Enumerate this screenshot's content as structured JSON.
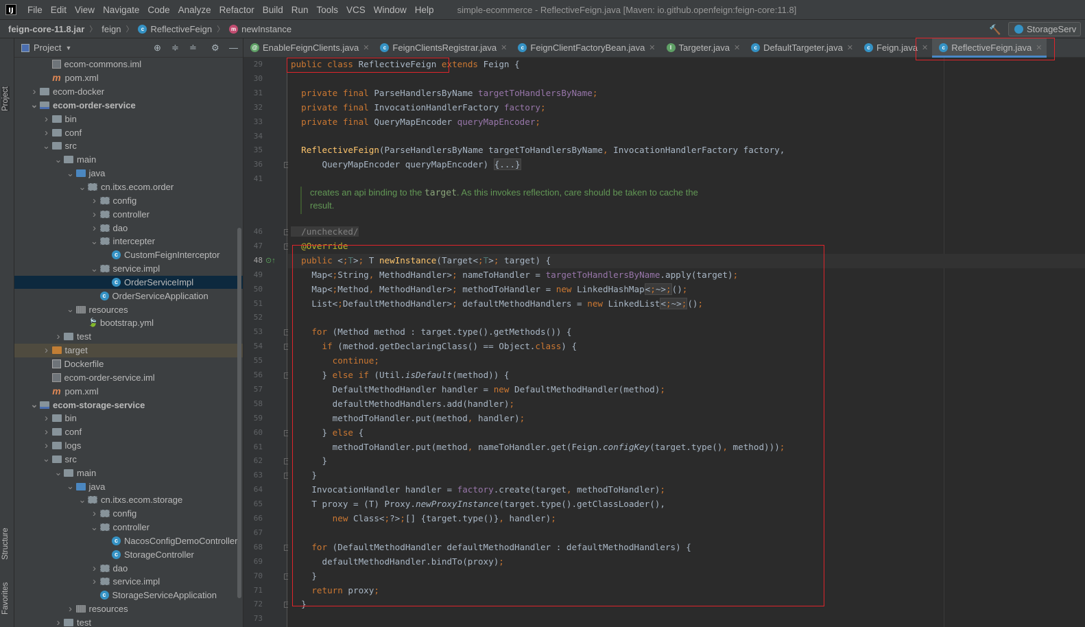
{
  "menubar": {
    "items": [
      "File",
      "Edit",
      "View",
      "Navigate",
      "Code",
      "Analyze",
      "Refactor",
      "Build",
      "Run",
      "Tools",
      "VCS",
      "Window",
      "Help"
    ],
    "window_title": "simple-ecommerce - ReflectiveFeign.java [Maven: io.github.openfeign:feign-core:11.8]"
  },
  "navbar": {
    "crumbs": [
      "feign-core-11.8.jar",
      "feign",
      "ReflectiveFeign",
      "newInstance"
    ],
    "run_config": "StorageServ"
  },
  "side_tabs": {
    "project": "Project",
    "structure": "Structure",
    "favorites": "Favorites"
  },
  "project": {
    "title": "Project",
    "tree": [
      {
        "label": "ecom-commons.iml",
        "indent": 3,
        "icon": "iml",
        "arrow": ""
      },
      {
        "label": "pom.xml",
        "indent": 3,
        "icon": "xml",
        "arrow": ""
      },
      {
        "label": "ecom-docker",
        "indent": 2,
        "icon": "folder",
        "arrow": ">"
      },
      {
        "label": "ecom-order-service",
        "indent": 2,
        "icon": "mod",
        "arrow": "v",
        "bold": true
      },
      {
        "label": "bin",
        "indent": 3,
        "icon": "folder",
        "arrow": ">"
      },
      {
        "label": "conf",
        "indent": 3,
        "icon": "folder",
        "arrow": ">"
      },
      {
        "label": "src",
        "indent": 3,
        "icon": "folder",
        "arrow": "v"
      },
      {
        "label": "main",
        "indent": 4,
        "icon": "folder",
        "arrow": "v"
      },
      {
        "label": "java",
        "indent": 5,
        "icon": "src",
        "arrow": "v"
      },
      {
        "label": "cn.itxs.ecom.order",
        "indent": 6,
        "icon": "pkg",
        "arrow": "v"
      },
      {
        "label": "config",
        "indent": 7,
        "icon": "pkg",
        "arrow": ">"
      },
      {
        "label": "controller",
        "indent": 7,
        "icon": "pkg",
        "arrow": ">"
      },
      {
        "label": "dao",
        "indent": 7,
        "icon": "pkg",
        "arrow": ">"
      },
      {
        "label": "intercepter",
        "indent": 7,
        "icon": "pkg",
        "arrow": "v"
      },
      {
        "label": "CustomFeignInterceptor",
        "indent": 8,
        "icon": "cls",
        "arrow": ""
      },
      {
        "label": "service.impl",
        "indent": 7,
        "icon": "pkg",
        "arrow": "v"
      },
      {
        "label": "OrderServiceImpl",
        "indent": 8,
        "icon": "cls",
        "arrow": "",
        "selected": true
      },
      {
        "label": "OrderServiceApplication",
        "indent": 7,
        "icon": "cls",
        "arrow": ""
      },
      {
        "label": "resources",
        "indent": 5,
        "icon": "res",
        "arrow": "v"
      },
      {
        "label": "bootstrap.yml",
        "indent": 6,
        "icon": "yml",
        "arrow": ""
      },
      {
        "label": "test",
        "indent": 4,
        "icon": "folder",
        "arrow": ">"
      },
      {
        "label": "target",
        "indent": 3,
        "icon": "tgt",
        "arrow": ">",
        "excluded": true
      },
      {
        "label": "Dockerfile",
        "indent": 3,
        "icon": "doc",
        "arrow": ""
      },
      {
        "label": "ecom-order-service.iml",
        "indent": 3,
        "icon": "iml",
        "arrow": ""
      },
      {
        "label": "pom.xml",
        "indent": 3,
        "icon": "xml",
        "arrow": ""
      },
      {
        "label": "ecom-storage-service",
        "indent": 2,
        "icon": "mod",
        "arrow": "v",
        "bold": true
      },
      {
        "label": "bin",
        "indent": 3,
        "icon": "folder",
        "arrow": ">"
      },
      {
        "label": "conf",
        "indent": 3,
        "icon": "folder",
        "arrow": ">"
      },
      {
        "label": "logs",
        "indent": 3,
        "icon": "folder",
        "arrow": ">"
      },
      {
        "label": "src",
        "indent": 3,
        "icon": "folder",
        "arrow": "v"
      },
      {
        "label": "main",
        "indent": 4,
        "icon": "folder",
        "arrow": "v"
      },
      {
        "label": "java",
        "indent": 5,
        "icon": "src",
        "arrow": "v"
      },
      {
        "label": "cn.itxs.ecom.storage",
        "indent": 6,
        "icon": "pkg",
        "arrow": "v"
      },
      {
        "label": "config",
        "indent": 7,
        "icon": "pkg",
        "arrow": ">"
      },
      {
        "label": "controller",
        "indent": 7,
        "icon": "pkg",
        "arrow": "v"
      },
      {
        "label": "NacosConfigDemoController",
        "indent": 8,
        "icon": "cls",
        "arrow": ""
      },
      {
        "label": "StorageController",
        "indent": 8,
        "icon": "cls",
        "arrow": ""
      },
      {
        "label": "dao",
        "indent": 7,
        "icon": "pkg",
        "arrow": ">"
      },
      {
        "label": "service.impl",
        "indent": 7,
        "icon": "pkg",
        "arrow": ">"
      },
      {
        "label": "StorageServiceApplication",
        "indent": 7,
        "icon": "cls",
        "arrow": ""
      },
      {
        "label": "resources",
        "indent": 5,
        "icon": "res",
        "arrow": ">"
      },
      {
        "label": "test",
        "indent": 4,
        "icon": "folder",
        "arrow": ">"
      }
    ]
  },
  "tabs": [
    {
      "label": "EnableFeignClients.java",
      "icon": "a"
    },
    {
      "label": "FeignClientsRegistrar.java",
      "icon": "c"
    },
    {
      "label": "FeignClientFactoryBean.java",
      "icon": "c"
    },
    {
      "label": "Targeter.java",
      "icon": "i"
    },
    {
      "label": "DefaultTargeter.java",
      "icon": "c"
    },
    {
      "label": "Feign.java",
      "icon": "c"
    },
    {
      "label": "ReflectiveFeign.java",
      "icon": "c",
      "active": true
    }
  ],
  "gutter_lines": [
    "29",
    "30",
    "31",
    "32",
    "33",
    "34",
    "35",
    "36",
    "41",
    "",
    "46",
    "47",
    "48",
    "49",
    "50",
    "51",
    "52",
    "53",
    "54",
    "55",
    "56",
    "57",
    "58",
    "59",
    "60",
    "61",
    "62",
    "63",
    "64",
    "65",
    "66",
    "67",
    "68",
    "69",
    "70",
    "71",
    "72",
    "73"
  ],
  "doc_comment": {
    "before": "creates an api binding to the ",
    "code": "target",
    "after": ". As this invokes reflection, care should be taken to cache the",
    "line2": "result."
  },
  "code_lines": [
    "public class ReflectiveFeign extends Feign {",
    "",
    "  private final ParseHandlersByName targetToHandlersByName;",
    "  private final InvocationHandlerFactory factory;",
    "  private final QueryMapEncoder queryMapEncoder;",
    "",
    "  ReflectiveFeign(ParseHandlersByName targetToHandlersByName, InvocationHandlerFactory factory,",
    "      QueryMapEncoder queryMapEncoder) {...}",
    "",
    "",
    "  /unchecked/",
    "  @Override",
    "  public <T> T newInstance(Target<T> target) {",
    "    Map<String, MethodHandler> nameToHandler = targetToHandlersByName.apply(target);",
    "    Map<Method, MethodHandler> methodToHandler = new LinkedHashMap<~>();",
    "    List<DefaultMethodHandler> defaultMethodHandlers = new LinkedList<~>();",
    "",
    "    for (Method method : target.type().getMethods()) {",
    "      if (method.getDeclaringClass() == Object.class) {",
    "        continue;",
    "      } else if (Util.isDefault(method)) {",
    "        DefaultMethodHandler handler = new DefaultMethodHandler(method);",
    "        defaultMethodHandlers.add(handler);",
    "        methodToHandler.put(method, handler);",
    "      } else {",
    "        methodToHandler.put(method, nameToHandler.get(Feign.configKey(target.type(), method)));",
    "      }",
    "    }",
    "    InvocationHandler handler = factory.create(target, methodToHandler);",
    "    T proxy = (T) Proxy.newProxyInstance(target.type().getClassLoader(),",
    "        new Class<?>[] {target.type()}, handler);",
    "",
    "    for (DefaultMethodHandler defaultMethodHandler : defaultMethodHandlers) {",
    "      defaultMethodHandler.bindTo(proxy);",
    "    }",
    "    return proxy;",
    "  }",
    ""
  ]
}
